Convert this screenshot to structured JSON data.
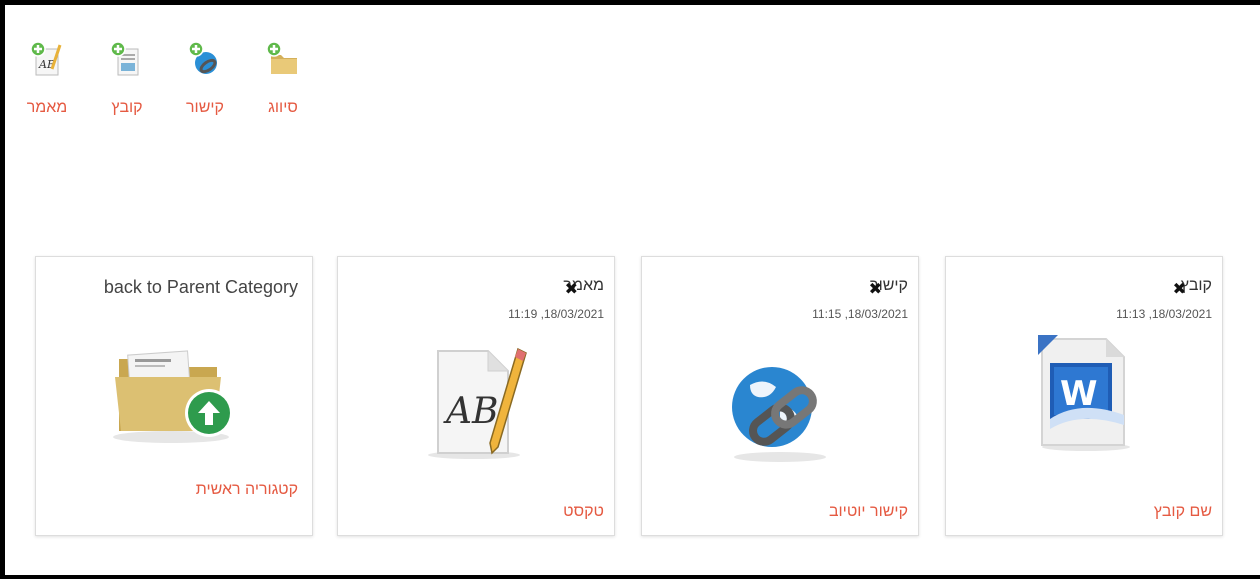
{
  "toolbar": {
    "items": [
      {
        "label": "מאמר",
        "icon": "add-article-icon"
      },
      {
        "label": "קובץ",
        "icon": "add-file-icon"
      },
      {
        "label": "קישור",
        "icon": "add-link-icon"
      },
      {
        "label": "סיווג",
        "icon": "add-category-icon"
      }
    ]
  },
  "cards": {
    "parent": {
      "title": "back to Parent Category",
      "link": "קטגוריה ראשית",
      "icon": "folder-up-icon"
    },
    "article": {
      "title": "מאמר",
      "date": "11:19 ,18/03/2021",
      "link": "טקסט",
      "icon": "article-icon"
    },
    "weblink": {
      "title": "קישור",
      "date": "11:15 ,18/03/2021",
      "link": "קישור יוטיוב",
      "icon": "globe-link-icon"
    },
    "file": {
      "title": "קובץ",
      "date": "11:13 ,18/03/2021",
      "link": "שם קובץ",
      "icon": "word-document-icon"
    }
  },
  "colors": {
    "accent": "#e55a42",
    "border": "#000000"
  }
}
